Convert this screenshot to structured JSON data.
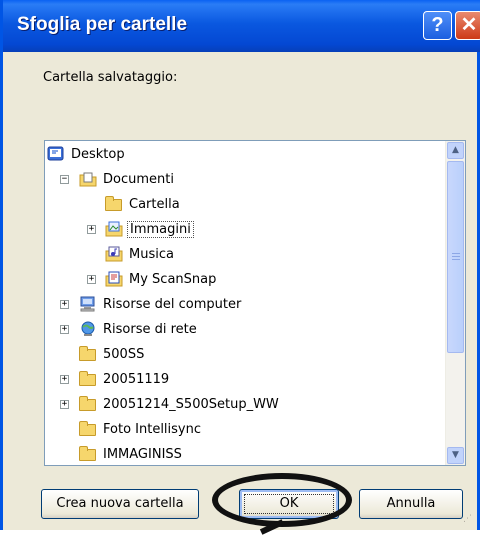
{
  "window": {
    "title": "Sfoglia per cartelle",
    "help_glyph": "?",
    "close_glyph": "✕"
  },
  "prompt_label": "Cartella salvataggio:",
  "tree": [
    {
      "label": "Desktop",
      "icon": "desktop-icon",
      "expander": ""
    },
    {
      "label": "Documenti",
      "icon": "documents-folder-icon",
      "expander": "−"
    },
    {
      "label": "Cartella",
      "icon": "folder-icon",
      "expander": ""
    },
    {
      "label": "Immagini",
      "icon": "pictures-folder-icon",
      "expander": "+"
    },
    {
      "label": "Musica",
      "icon": "music-folder-icon",
      "expander": ""
    },
    {
      "label": "My ScanSnap",
      "icon": "scansnap-folder-icon",
      "expander": "+"
    },
    {
      "label": "Risorse del computer",
      "icon": "computer-icon",
      "expander": "+"
    },
    {
      "label": "Risorse di rete",
      "icon": "network-icon",
      "expander": "+"
    },
    {
      "label": "500SS",
      "icon": "folder-icon",
      "expander": ""
    },
    {
      "label": "20051119",
      "icon": "folder-icon",
      "expander": "+"
    },
    {
      "label": "20051214_S500Setup_WW",
      "icon": "folder-icon",
      "expander": "+"
    },
    {
      "label": "Foto Intellisync",
      "icon": "folder-icon",
      "expander": ""
    },
    {
      "label": "IMMAGINISS",
      "icon": "folder-icon",
      "expander": ""
    }
  ],
  "scrollbar": {
    "up_glyph": "▲",
    "down_glyph": "▼"
  },
  "buttons": {
    "new_folder": "Crea nuova cartella",
    "ok": "OK",
    "cancel": "Annulla"
  },
  "colors": {
    "titlebar": "#0a58e0",
    "dialog_bg": "#ece9d8",
    "annotation": "#111111"
  }
}
